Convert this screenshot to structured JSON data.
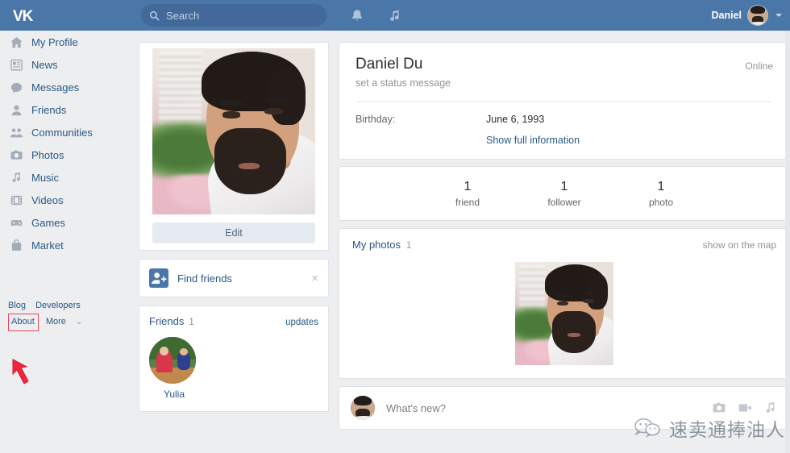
{
  "header": {
    "logo": "vk-logo",
    "search": {
      "placeholder": "Search",
      "value": "",
      "icon": "search-icon"
    },
    "icons": [
      {
        "name": "bell-icon",
        "label": "Notifications"
      },
      {
        "name": "music-icon",
        "label": "Music"
      }
    ],
    "user": {
      "name": "Daniel",
      "avatar": "user-avatar",
      "caret": "chevron-down-icon"
    }
  },
  "sidebar": {
    "items": [
      {
        "label": "My Profile",
        "icon": "home-icon"
      },
      {
        "label": "News",
        "icon": "news-icon"
      },
      {
        "label": "Messages",
        "icon": "message-icon"
      },
      {
        "label": "Friends",
        "icon": "person-icon"
      },
      {
        "label": "Communities",
        "icon": "people-icon"
      },
      {
        "label": "Photos",
        "icon": "camera-icon"
      },
      {
        "label": "Music",
        "icon": "note-icon"
      },
      {
        "label": "Videos",
        "icon": "film-icon"
      },
      {
        "label": "Games",
        "icon": "gamepad-icon"
      },
      {
        "label": "Market",
        "icon": "bag-icon"
      }
    ],
    "footer_links": [
      {
        "label": "Blog",
        "highlighted": false
      },
      {
        "label": "Developers",
        "highlighted": false
      },
      {
        "label": "About",
        "highlighted": true
      },
      {
        "label": "More",
        "highlighted": false
      }
    ],
    "more_caret": "⌄",
    "annotation": {
      "color": "#e8425a",
      "target": "About",
      "type": "red-arrow"
    }
  },
  "left_column": {
    "profile_photo_alt": "profile-photo-man-beard-white-shirt",
    "edit_button": "Edit",
    "find_friends": {
      "label": "Find friends",
      "icon": "add-friend-icon",
      "close": "×"
    },
    "friends": {
      "title": "Friends",
      "count": "1",
      "updates_link": "updates",
      "list": [
        {
          "name": "Yulia",
          "avatar": "friend-avatar-yulia"
        }
      ]
    }
  },
  "profile": {
    "name": "Daniel Du",
    "status_message": "set a status message",
    "online": "Online",
    "birthday_label": "Birthday:",
    "birthday_value": "June 6, 1993",
    "show_full_information": "Show full information",
    "stats": [
      {
        "number": "1",
        "label": "friend"
      },
      {
        "number": "1",
        "label": "follower"
      },
      {
        "number": "1",
        "label": "photo"
      }
    ]
  },
  "photos_section": {
    "title": "My photos",
    "count": "1",
    "map_link": "show on the map",
    "thumbnail_alt": "photo-thumb-man-beard"
  },
  "post_box": {
    "placeholder": "What's new?",
    "avatar": "post-avatar",
    "actions": [
      {
        "name": "photo-attach-icon"
      },
      {
        "name": "video-attach-icon"
      },
      {
        "name": "music-attach-icon"
      }
    ]
  },
  "watermark": {
    "text": "速卖通捧油人",
    "icon": "wechat-icon"
  },
  "colors": {
    "header_blue": "#4a76a8",
    "link_blue": "#2a5885",
    "page_bg": "#edeef0",
    "card_bg": "#ffffff",
    "annotation_red": "#e8425a"
  }
}
